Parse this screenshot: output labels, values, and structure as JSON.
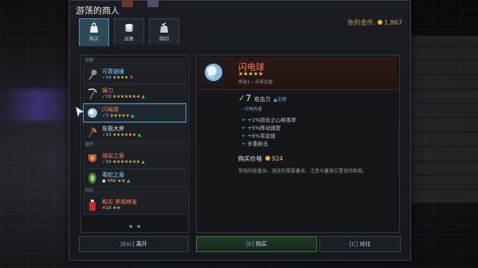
{
  "window": {
    "title": "游荡的商人",
    "gold_label": "你的金币:",
    "gold_amount": "1,867"
  },
  "tabs": [
    {
      "label": "购买",
      "icon": "bag-icon",
      "active": true
    },
    {
      "label": "出售",
      "icon": "coins-icon",
      "active": false
    },
    {
      "label": "购回",
      "icon": "buyback-icon",
      "active": false
    }
  ],
  "sections": {
    "weapons": "武器",
    "armor": "装甲",
    "potions": "药水"
  },
  "items": [
    {
      "name": "可靠链锤",
      "level": "14",
      "stars": "★★★★",
      "trend": "▼",
      "trend_dir": "down",
      "name_color": "#7fd0ff",
      "icon": "chain-flail-icon"
    },
    {
      "name": "镰刀",
      "level": "19",
      "stars": "★★★★★★★",
      "trend": "▲",
      "trend_dir": "up",
      "name_color": "#ff7a50",
      "icon": "scythe-icon"
    },
    {
      "name": "闪电球",
      "level": "7",
      "stars": "★★★★★",
      "trend": "▲",
      "trend_dir": "up",
      "name_color": "#ff7a50",
      "icon": "lightning-orb-icon"
    },
    {
      "name": "灰斑大斧",
      "level": "13",
      "stars": "★★★★★★",
      "trend": "▲",
      "trend_dir": "up",
      "name_color": "#e6ecef",
      "icon": "great-axe-icon"
    },
    {
      "name": "熔岩之盾",
      "level": "34",
      "stars": "★★★★★★★",
      "trend": "▲",
      "trend_dir": "up",
      "name_color": "#ff7a50",
      "icon": "lava-shield-icon"
    },
    {
      "name": "毒蛇之盾",
      "level": "66",
      "stars": "★★",
      "trend": "▲",
      "trend_dir": "up",
      "name_color": "#7fd0ff",
      "icon": "viper-shield-icon"
    },
    {
      "name": "粗劣 黑缎麻雀",
      "level": "18",
      "stars": "★★",
      "trend": "",
      "trend_dir": "none",
      "name_color": "#ff7a50",
      "icon": "potion-icon"
    }
  ],
  "page_dots": "● ●",
  "detail": {
    "name": "闪电球",
    "stars": "★★★★★",
    "subtitle": "等级3 • 传奇武器",
    "attack_value": "7",
    "attack_label": "攻击力",
    "attack_compare": "▲全新",
    "damage_type": "闪电伤害",
    "bonuses": [
      "+1%回合之心掉落率",
      "+5%移动速度",
      "+6%幸运值",
      "多重射击"
    ],
    "price_label": "购买价格",
    "price": "924",
    "description": "带电的能量球，施放前需要蓄准，注意与蓄准位置保持距离。"
  },
  "buttons": {
    "leave_key": "[Esc]",
    "leave": "离开",
    "buy_key": "[E]",
    "buy": "购买",
    "compare_key": "[C]",
    "compare": "对比"
  }
}
